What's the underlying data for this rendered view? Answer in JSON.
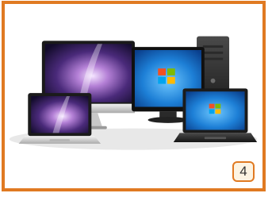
{
  "card": {
    "frame_color": "#e07a22",
    "badge": {
      "label": "4",
      "background": "#fdf4e3"
    }
  },
  "photo": {
    "subject": "computer-devices-group",
    "devices": [
      {
        "type": "desktop-monitor",
        "wallpaper": "purple-aurora"
      },
      {
        "type": "desktop-monitor",
        "wallpaper": "windows-7"
      },
      {
        "type": "tower-pc"
      },
      {
        "type": "laptop",
        "wallpaper": "purple-aurora"
      },
      {
        "type": "laptop",
        "wallpaper": "windows-7"
      }
    ]
  }
}
